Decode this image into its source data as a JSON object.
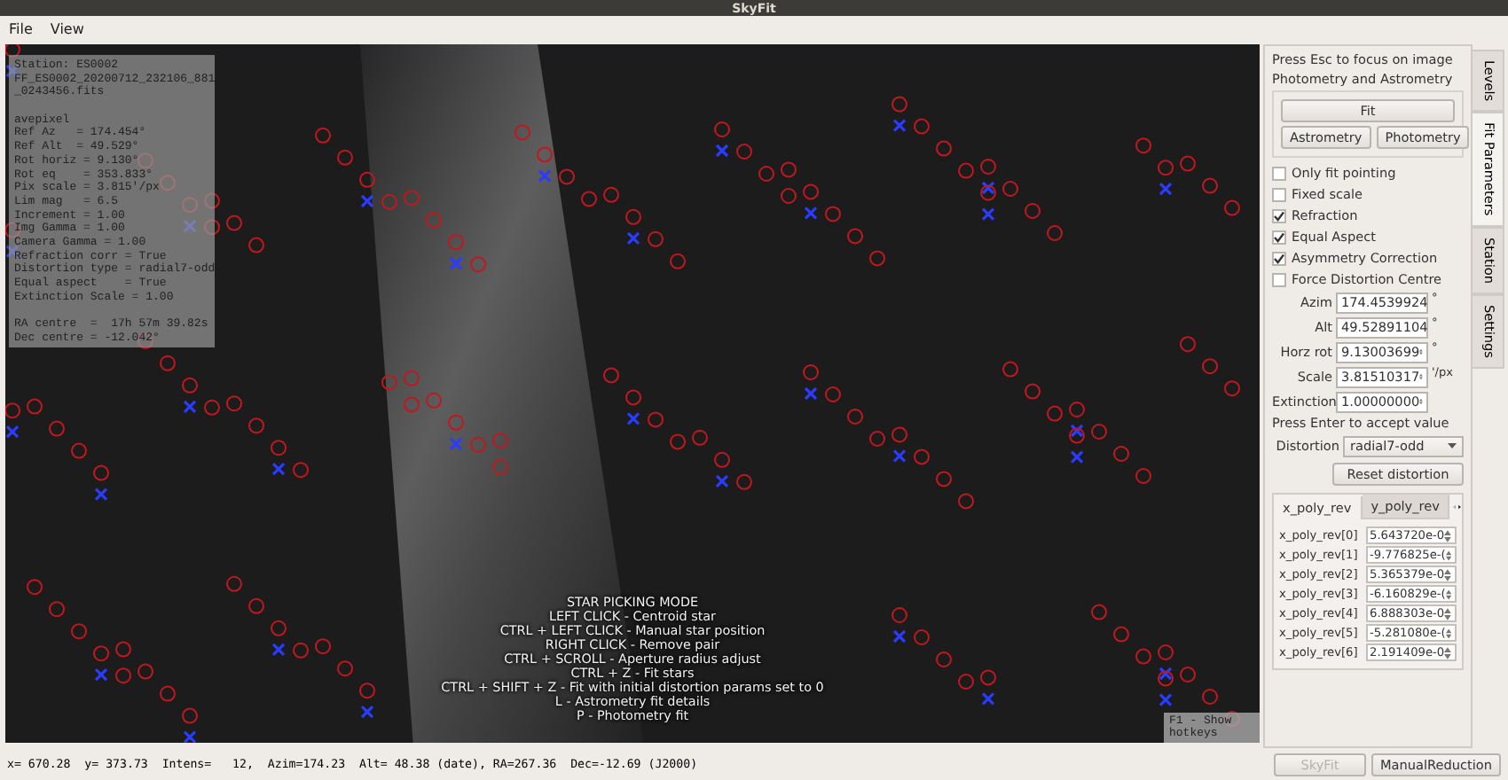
{
  "window": {
    "title": "SkyFit"
  },
  "menu": [
    "File",
    "View"
  ],
  "info_panel": {
    "blocks": [
      [
        "Station: ES0002",
        "FF_ES0002_20200712_232106_881",
        "_0243456.fits"
      ],
      [
        "avepixel",
        "Ref Az   = 174.454°",
        "Ref Alt  = 49.529°",
        "Rot horiz = 9.130°",
        "Rot eq    = 353.833°",
        "Pix scale = 3.815'/px",
        "Lim mag   = 6.5",
        "Increment = 1.00",
        "Img Gamma = 1.00",
        "Camera Gamma = 1.00",
        "Refraction corr = True",
        "Distortion type = radial7-odd",
        "Equal aspect    = True",
        "Extinction Scale = 1.00"
      ],
      [
        "RA centre  =  17h 57m 39.82s",
        "Dec centre = -12.042°"
      ]
    ]
  },
  "help_overlay": [
    "STAR PICKING MODE",
    "LEFT CLICK - Centroid star",
    "CTRL + LEFT CLICK - Manual star position",
    "RIGHT CLICK - Remove pair",
    "CTRL + SCROLL - Aperture radius adjust",
    "CTRL + Z - Fit stars",
    "CTRL + SHIFT + Z - Fit with initial distortion params set to 0",
    "L - Astrometry fit details",
    "P - Photometry fit"
  ],
  "hotkeys_hint": "F1 - Show hotkeys",
  "panel": {
    "hint": "Press Esc to focus on image",
    "group_title": "Photometry and Astrometry",
    "fit_button": "Fit",
    "buttons": [
      "Astrometry",
      "Photometry"
    ],
    "checkboxes": [
      {
        "label": "Only fit pointing",
        "checked": false
      },
      {
        "label": "Fixed scale",
        "checked": false
      },
      {
        "label": "Refraction",
        "checked": true
      },
      {
        "label": "Equal Aspect",
        "checked": true
      },
      {
        "label": "Asymmetry Correction",
        "checked": true
      },
      {
        "label": "Force Distortion Centre",
        "checked": false
      }
    ],
    "fields": [
      {
        "label": "Azim",
        "value": "174.4539924",
        "unit": "°"
      },
      {
        "label": "Alt",
        "value": "49.52891104",
        "unit": "°"
      },
      {
        "label": "Horz rot",
        "value": "9.13003699",
        "unit": "°"
      },
      {
        "label": "Scale",
        "value": "3.81510317",
        "unit": "'/px"
      },
      {
        "label": "Extinction",
        "value": "1.00000000"
      }
    ],
    "enter_hint": "Press Enter to accept value",
    "distortion": {
      "label": "Distortion",
      "value": "radial7-odd"
    },
    "reset_button": "Reset distortion",
    "poly_tabs": [
      {
        "label": "x_poly_rev",
        "selected": true
      },
      {
        "label": "y_poly_rev",
        "selected": false
      }
    ],
    "poly_rows": [
      {
        "label": "x_poly_rev[0]",
        "value": "5.643720e-0"
      },
      {
        "label": "x_poly_rev[1]",
        "value": "-9.776825e-("
      },
      {
        "label": "x_poly_rev[2]",
        "value": "5.365379e-0"
      },
      {
        "label": "x_poly_rev[3]",
        "value": "-6.160829e-("
      },
      {
        "label": "x_poly_rev[4]",
        "value": "6.888303e-0"
      },
      {
        "label": "x_poly_rev[5]",
        "value": "-5.281080e-("
      },
      {
        "label": "x_poly_rev[6]",
        "value": "2.191409e-0"
      }
    ]
  },
  "side_tabs": [
    {
      "label": "Levels",
      "selected": false
    },
    {
      "label": "Fit Parameters",
      "selected": true
    },
    {
      "label": "Station",
      "selected": false
    },
    {
      "label": "Settings",
      "selected": false
    }
  ],
  "status_bar": {
    "text": "x= 670.28  y= 373.73  Intens=   12,  Azim=174.23  Alt= 48.38 (date), RA=267.36  Dec=-12.69 (J2000)",
    "buttons": [
      {
        "label": "SkyFit",
        "disabled": true
      },
      {
        "label": "ManualReduction",
        "disabled": false
      }
    ]
  }
}
